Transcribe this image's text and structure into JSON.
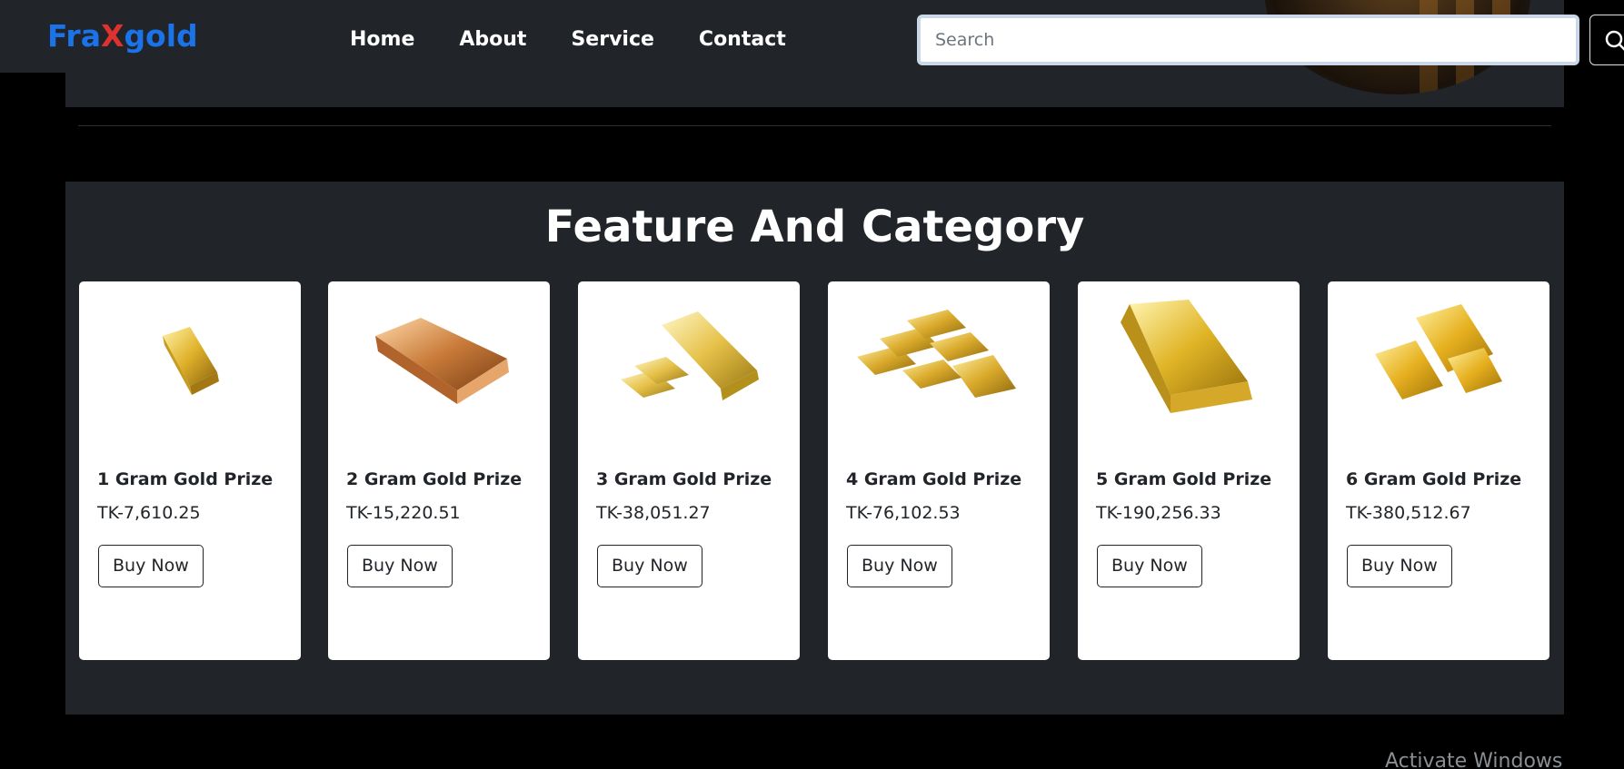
{
  "navbar": {
    "brand": {
      "part1": "Fra",
      "part2": "X",
      "part3": "gold"
    },
    "links": [
      "Home",
      "About",
      "Service",
      "Contact"
    ],
    "search_placeholder": "Search"
  },
  "feature": {
    "title": "Feature And Category",
    "cards": [
      {
        "title": "1 Gram Gold Prize",
        "price": "TK-7,610.25",
        "button": "Buy Now"
      },
      {
        "title": "2 Gram Gold Prize",
        "price": "TK-15,220.51",
        "button": "Buy Now"
      },
      {
        "title": "3 Gram Gold Prize",
        "price": "TK-38,051.27",
        "button": "Buy Now"
      },
      {
        "title": "4 Gram Gold Prize",
        "price": "TK-76,102.53",
        "button": "Buy Now"
      },
      {
        "title": "5 Gram Gold Prize",
        "price": "TK-190,256.33",
        "button": "Buy Now"
      },
      {
        "title": "6 Gram Gold Prize",
        "price": "TK-380,512.67",
        "button": "Buy Now"
      }
    ]
  },
  "watermark": "Activate Windows",
  "colors": {
    "brand": "#1a73e8",
    "brand_x": "#e03131",
    "panel": "#212529",
    "background": "#000000"
  }
}
